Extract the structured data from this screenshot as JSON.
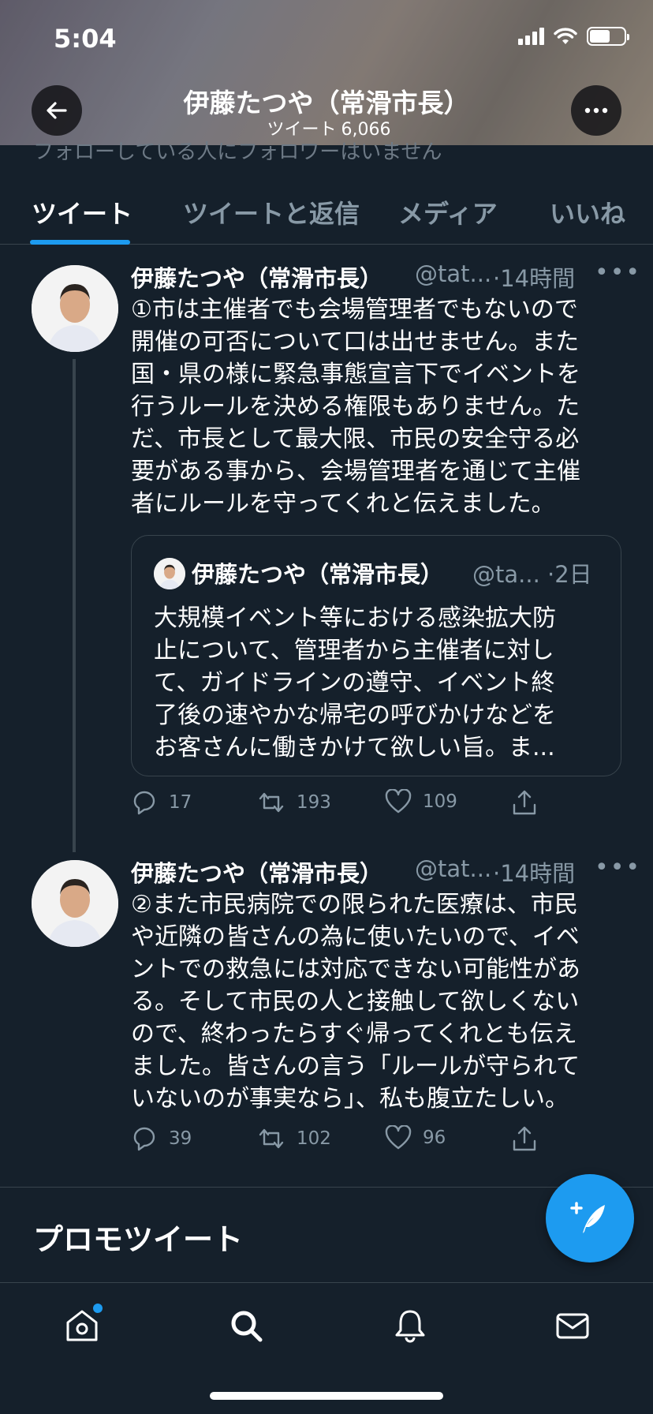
{
  "status_bar": {
    "time": "5:04"
  },
  "header": {
    "title": "伊藤たつや（常滑市長）",
    "tweet_count_label": "ツイート",
    "tweet_count": "6,066"
  },
  "profile_fragment": "フォローしている人にフォロワーはいません",
  "tabs": [
    {
      "label": "ツイート",
      "active": true
    },
    {
      "label": "ツイートと返信",
      "active": false
    },
    {
      "label": "メディア",
      "active": false
    },
    {
      "label": "いいね",
      "active": false
    }
  ],
  "tweets": [
    {
      "name": "伊藤たつや（常滑市長）",
      "handle": "@tat...",
      "time": "·14時間",
      "text": "①市は主催者でも会場管理者でもないので\n開催の可否について口は出せません。また\n国・県の様に緊急事態宣言下でイベントを\n行うルールを決める権限もありません。た\nだ、市長として最大限、市民の安全守る必\n要がある事から、会場管理者を通じて主催\n者にルールを守ってくれと伝えました。",
      "quote": {
        "name": "伊藤たつや（常滑市長）",
        "handle": "@ta...",
        "time": "·2日",
        "text": "大規模イベント等における感染拡大防\n止について、管理者から主催者に対し\nて、ガイドラインの遵守、イベント終\n了後の速やかな帰宅の呼びかけなどを\nお客さんに働きかけて欲しい旨。ま..."
      },
      "replies": "17",
      "retweets": "193",
      "likes": "109"
    },
    {
      "name": "伊藤たつや（常滑市長）",
      "handle": "@tat...",
      "time": "·14時間",
      "text": "②また市民病院での限られた医療は、市民\nや近隣の皆さんの為に使いたいので、イベ\nントでの救急には対応できない可能性があ\nる。そして市民の人と接触して欲しくない\nので、終わったらすぐ帰ってくれとも伝え\nました。皆さんの言う「ルールが守られて\nいないのが事実なら」、私も腹立たしい。",
      "replies": "39",
      "retweets": "102",
      "likes": "96"
    }
  ],
  "promo_heading": "プロモツイート",
  "nav": [
    "home-icon",
    "search-icon",
    "bell-icon",
    "mail-icon"
  ],
  "colors": {
    "background": "#15202b",
    "accent": "#1d9bf0",
    "muted": "#8899a6",
    "border": "#38444d"
  }
}
